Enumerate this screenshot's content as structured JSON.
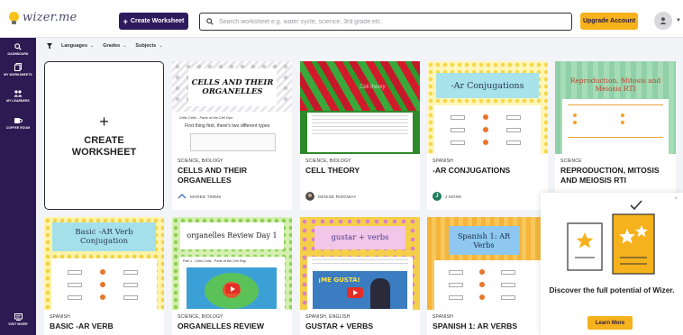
{
  "app": {
    "logo_text": "wizer.me"
  },
  "header": {
    "create_label": "Create Worksheet",
    "search_placeholder": "Search worksheet e.g. water cycle, science, 3rd grade etc.",
    "upgrade_label": "Upgrade Account"
  },
  "sidebar": {
    "items": [
      {
        "label": "DASHBOARD",
        "icon": "search-icon"
      },
      {
        "label": "MY WORKSHEETS",
        "icon": "worksheets-icon"
      },
      {
        "label": "MY LEARNERS",
        "icon": "learners-icon"
      },
      {
        "label": "COFFEE ROOM",
        "icon": "coffee-icon"
      },
      {
        "label": "VISIT WIZER",
        "icon": "visit-icon"
      }
    ]
  },
  "filters": {
    "items": [
      "Languages",
      "Grades",
      "Subjects"
    ]
  },
  "create_card": {
    "plus": "+",
    "label": "CREATE WORKSHEET"
  },
  "cards": [
    {
      "category": "SCIENCE, BIOLOGY",
      "title": "CELLS AND THEIR ORGANELLES",
      "author": "MAREE TIMMS",
      "thumb_title": "CELLS AND THEIR ORGANELLES",
      "thumb_sub": "First thing first, there's two different types",
      "thumb_head": "Cells Cells - Parts of the Cell Duo"
    },
    {
      "category": "SCIENCE, BIOLOGY",
      "title": "CELL THEORY",
      "author": "DENISE RIDGWAY",
      "thumb_head": "Cell theory"
    },
    {
      "category": "SPANISH",
      "title": "-AR CONJUGATIONS",
      "author": "J MONK",
      "author_initial": "J",
      "thumb_title": "-Ar Conjugations"
    },
    {
      "category": "SCIENCE",
      "title": "REPRODUCTION, MITOSIS AND MEIOSIS RTI",
      "author": "",
      "thumb_title": "Reproduction, Mitosis and Meiosis RTI"
    },
    {
      "category": "SPANISH",
      "title": "BASIC -AR VERB",
      "author": "",
      "thumb_title": "Basic -AR Verb Conjugation"
    },
    {
      "category": "SCIENCE, BIOLOGY",
      "title": "ORGANELLES REVIEW",
      "author": "",
      "thumb_title": "organelles Review Day 1",
      "thumb_head": "Part 1 - Cells Cells - Parts of the Cell Rap"
    },
    {
      "category": "SPANISH, ENGLISH",
      "title": "GUSTAR + VERBS",
      "author": "",
      "thumb_title": "gustar + verbs",
      "thumb_text": "¡ME GUSTA!"
    },
    {
      "category": "SPANISH",
      "title": "SPANISH 1: AR VERBS",
      "author": "",
      "thumb_title": "Spanish 1: AR Verbs"
    }
  ],
  "popup": {
    "message": "Discover the full potential of Wizer.",
    "button": "Learn More",
    "close": "×"
  },
  "colors": {
    "brand_purple": "#2e1a52",
    "accent_yellow": "#f6b21c",
    "video_red": "#e52d27"
  }
}
